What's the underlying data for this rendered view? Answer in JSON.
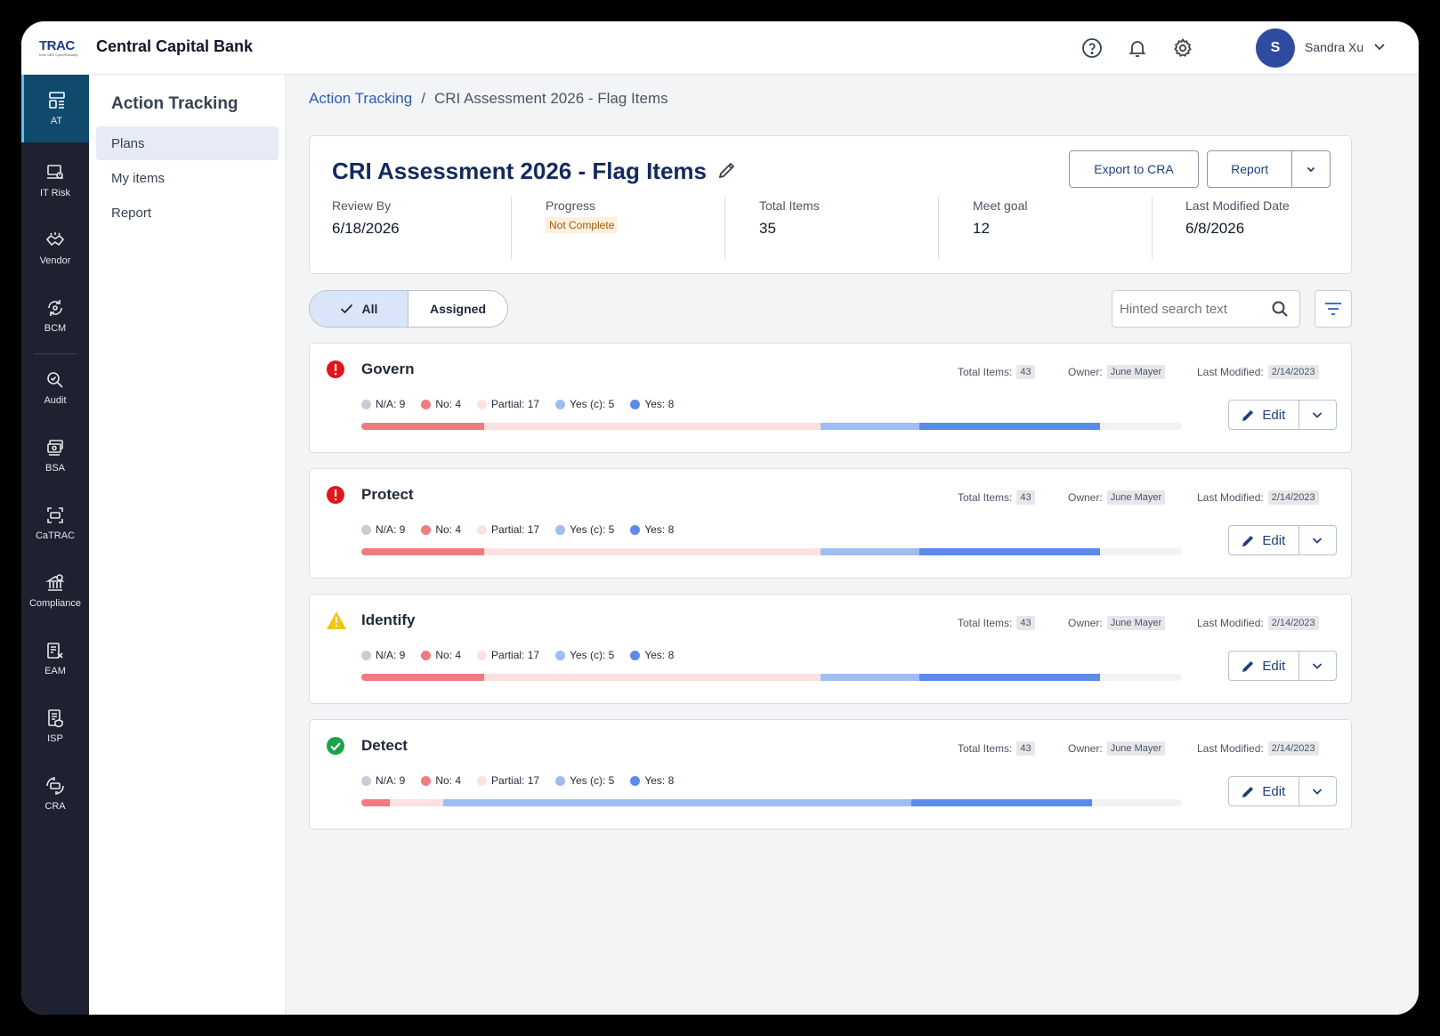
{
  "brand": {
    "logo_text": "TRAC",
    "logo_sub": "from SBS CyberSecurity",
    "bank_name": "Central Capital Bank"
  },
  "user": {
    "initial": "S",
    "name": "Sandra Xu"
  },
  "rail": [
    {
      "label": "AT",
      "icon": "action-tracking-icon",
      "active": true
    },
    {
      "label": "IT Risk",
      "icon": "it-risk-icon"
    },
    {
      "label": "Vendor",
      "icon": "vendor-icon"
    },
    {
      "label": "BCM",
      "icon": "bcm-icon"
    },
    {
      "label": "Audit",
      "icon": "audit-icon"
    },
    {
      "label": "BSA",
      "icon": "bsa-icon"
    },
    {
      "label": "CaTRAC",
      "icon": "catrac-icon"
    },
    {
      "label": "Compliance",
      "icon": "compliance-icon"
    },
    {
      "label": "EAM",
      "icon": "eam-icon"
    },
    {
      "label": "ISP",
      "icon": "isp-icon"
    },
    {
      "label": "CRA",
      "icon": "cra-icon"
    }
  ],
  "subnav": {
    "title": "Action Tracking",
    "items": [
      {
        "label": "Plans",
        "active": true
      },
      {
        "label": "My items"
      },
      {
        "label": "Report"
      }
    ]
  },
  "breadcrumb": {
    "root": "Action Tracking",
    "sep": "/",
    "current": "CRI Assessment 2026 - Flag Items"
  },
  "header": {
    "title": "CRI Assessment 2026 - Flag Items",
    "export_label": "Export to CRA",
    "report_label": "Report",
    "stats": [
      {
        "label": "Review By",
        "value": "6/18/2026"
      },
      {
        "label": "Progress",
        "badge": "Not Complete"
      },
      {
        "label": "Total Items",
        "value": "35"
      },
      {
        "label": "Meet goal",
        "value": "12"
      },
      {
        "label": "Last Modified Date",
        "value": "6/8/2026"
      }
    ]
  },
  "filters": {
    "all_label": "All",
    "assigned_label": "Assigned",
    "search_placeholder": "Hinted search text"
  },
  "colors": {
    "na": "#c9ccd6",
    "no": "#f07b7e",
    "partial": "#fde0e0",
    "yes_c": "#9fbdf3",
    "yes": "#5a8be8"
  },
  "rows": [
    {
      "name": "Govern",
      "status": "error",
      "total_label": "Total Items:",
      "total": "43",
      "owner_label": "Owner:",
      "owner": "June Mayer",
      "modified_label": "Last Modified:",
      "modified": "2/14/2023",
      "legend": [
        "N/A: 9",
        "No: 4",
        "Partial: 17",
        "Yes (c): 5",
        "Yes: 8"
      ],
      "bar_fractions": [
        0.15,
        0.41,
        0.12,
        0.22
      ],
      "edit_label": "Edit"
    },
    {
      "name": "Protect",
      "status": "error",
      "total_label": "Total Items:",
      "total": "43",
      "owner_label": "Owner:",
      "owner": "June Mayer",
      "modified_label": "Last Modified:",
      "modified": "2/14/2023",
      "legend": [
        "N/A: 9",
        "No: 4",
        "Partial: 17",
        "Yes (c): 5",
        "Yes: 8"
      ],
      "bar_fractions": [
        0.15,
        0.41,
        0.12,
        0.22
      ],
      "edit_label": "Edit"
    },
    {
      "name": "Identify",
      "status": "warning",
      "total_label": "Total Items:",
      "total": "43",
      "owner_label": "Owner:",
      "owner": "June Mayer",
      "modified_label": "Last Modified:",
      "modified": "2/14/2023",
      "legend": [
        "N/A: 9",
        "No: 4",
        "Partial: 17",
        "Yes (c): 5",
        "Yes: 8"
      ],
      "bar_fractions": [
        0.15,
        0.41,
        0.12,
        0.22
      ],
      "edit_label": "Edit"
    },
    {
      "name": "Detect",
      "status": "success",
      "total_label": "Total Items:",
      "total": "43",
      "owner_label": "Owner:",
      "owner": "June Mayer",
      "modified_label": "Last Modified:",
      "modified": "2/14/2023",
      "legend": [
        "N/A: 9",
        "No: 4",
        "Partial: 17",
        "Yes (c): 5",
        "Yes: 8"
      ],
      "bar_fractions": [
        0.035,
        0.065,
        0.57,
        0.22
      ],
      "edit_label": "Edit"
    }
  ]
}
